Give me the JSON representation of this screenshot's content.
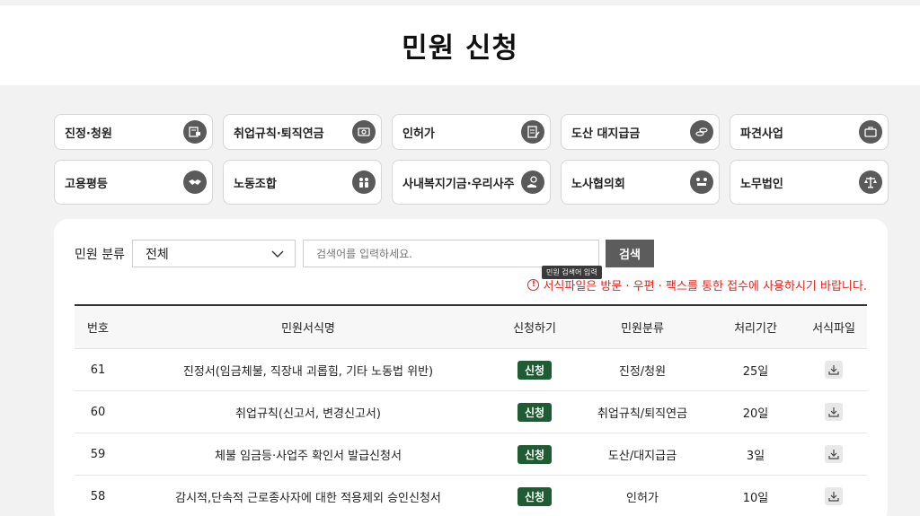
{
  "header": {
    "title": "민원 신청"
  },
  "categories": [
    {
      "label": "진정·청원",
      "icon": "document-stamp-icon"
    },
    {
      "label": "취업규칙·퇴직연금",
      "icon": "money-icon"
    },
    {
      "label": "인허가",
      "icon": "document-pen-icon"
    },
    {
      "label": "도산 대지급금",
      "icon": "coins-icon"
    },
    {
      "label": "파견사업",
      "icon": "briefcase-icon"
    },
    {
      "label": "고용평등",
      "icon": "handshake-icon"
    },
    {
      "label": "노동조합",
      "icon": "people-icon"
    },
    {
      "label": "사내복지기금·우리사주",
      "icon": "hand-coin-icon"
    },
    {
      "label": "노사협의회",
      "icon": "meeting-icon"
    },
    {
      "label": "노무법인",
      "icon": "scales-icon"
    }
  ],
  "search": {
    "label": "민원 분류",
    "select_value": "전체",
    "placeholder": "검색어를 입력하세요.",
    "button": "검색",
    "tooltip": "민원 검색어 입력"
  },
  "notice": {
    "icon": "!",
    "text": "서식파일은 방문 · 우편 · 팩스를 통한 접수에 사용하시기 바랍니다."
  },
  "table": {
    "headers": {
      "no": "번호",
      "name": "민원서식명",
      "apply": "신청하기",
      "category": "민원분류",
      "period": "처리기간",
      "file": "서식파일"
    },
    "rows": [
      {
        "no": "61",
        "name": "진정서(임금체불, 직장내 괴롭힘, 기타 노동법 위반)",
        "apply": "신청",
        "category": "진정/청원",
        "period": "25일"
      },
      {
        "no": "60",
        "name": "취업규칙(신고서, 변경신고서)",
        "apply": "신청",
        "category": "취업규칙/퇴직연금",
        "period": "20일"
      },
      {
        "no": "59",
        "name": "체불 임금등·사업주 확인서 발급신청서",
        "apply": "신청",
        "category": "도산/대지급금",
        "period": "3일"
      },
      {
        "no": "58",
        "name": "감시적,단속적 근로종사자에 대한 적용제외 승인신청서",
        "apply": "신청",
        "category": "인허가",
        "period": "10일"
      }
    ]
  },
  "colors": {
    "accent_green": "#1f5c34",
    "notice_red": "#e0261f",
    "search_button": "#5c5c5c"
  }
}
